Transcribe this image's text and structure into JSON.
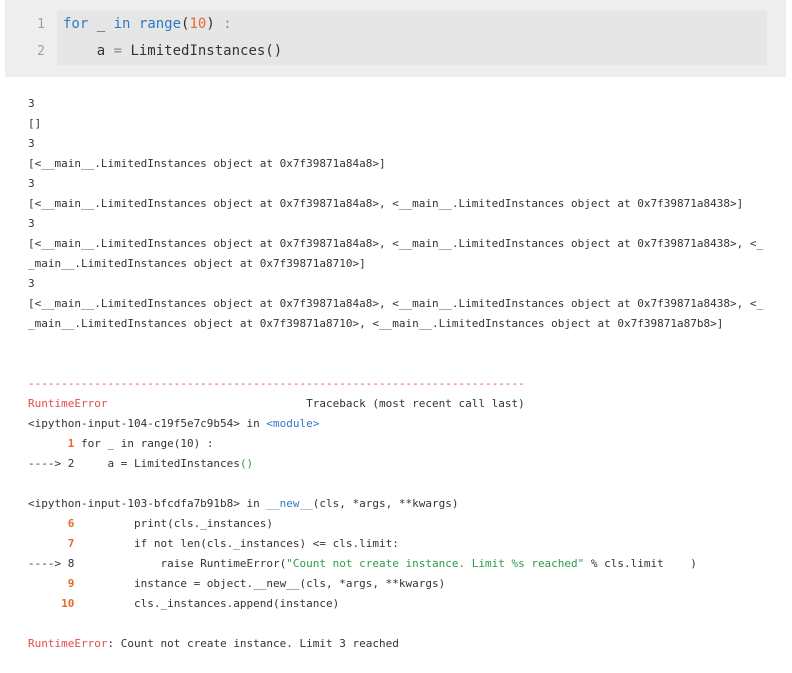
{
  "cell": {
    "line_numbers": [
      "1",
      "2"
    ],
    "line1": {
      "kw": "for",
      "var": " _ ",
      "in": "in",
      "sp": " ",
      "fn": "range",
      "open": "(",
      "num": "10",
      "close": ")",
      "colon": " :"
    },
    "line2": {
      "indent": "    a ",
      "eq": "=",
      "rest": " LimitedInstances()"
    }
  },
  "output": [
    "3",
    "[]",
    "3",
    "[<__main__.LimitedInstances object at 0x7f39871a84a8>]",
    "3",
    "[<__main__.LimitedInstances object at 0x7f39871a84a8>, <__main__.LimitedInstances object at 0x7f39871a8438>]",
    "3",
    "[<__main__.LimitedInstances object at 0x7f39871a84a8>, <__main__.LimitedInstances object at 0x7f39871a8438>, <_",
    "_main__.LimitedInstances object at 0x7f39871a8710>]",
    "3",
    "[<__main__.LimitedInstances object at 0x7f39871a84a8>, <__main__.LimitedInstances object at 0x7f39871a8438>, <_",
    "_main__.LimitedInstances object at 0x7f39871a8710>, <__main__.LimitedInstances object at 0x7f39871a87b8>]"
  ],
  "traceback": {
    "dashes": "---------------------------------------------------------------------------",
    "error_name": "RuntimeError",
    "header_right": "                              Traceback (most recent call last)",
    "frame1_file": "<ipython-input-104-c19f5e7c9b54>",
    "frame1_in": " in ",
    "frame1_func": "<module>",
    "f1_l1_num": "      1",
    "f1_l1_kw": " for",
    "f1_l1_rest": " _ in range(10) ",
    "f1_l1_colon": ":",
    "f1_l2_arrow": "----> 2",
    "f1_l2_code": "     a = LimitedInstances",
    "f1_l2_paren": "()",
    "frame2_file": "<ipython-input-103-bfcdfa7b91b8>",
    "frame2_in": " in ",
    "frame2_func": "__new__",
    "frame2_args": "(cls, *args, **kwargs)",
    "f2_l6_num": "      6",
    "f2_l6_code": "         print(cls._instances)",
    "f2_l7_num": "      7",
    "f2_l7_code": "         if not len(cls._instances) <= cls.limit:",
    "f2_l8_arrow": "----> 8",
    "f2_l8_pre": "             raise RuntimeError(",
    "f2_l8_str": "\"Count not create instance. Limit %s reached\"",
    "f2_l8_post": " % cls.limit    )",
    "f2_l9_num": "      9",
    "f2_l9_code": "         instance = object.__new__(cls, *args, **kwargs)",
    "f2_l10_num": "     10",
    "f2_l10_code": "         cls._instances.append(instance)",
    "final_name": "RuntimeError",
    "final_msg": ": Count not create instance. Limit 3 reached"
  }
}
